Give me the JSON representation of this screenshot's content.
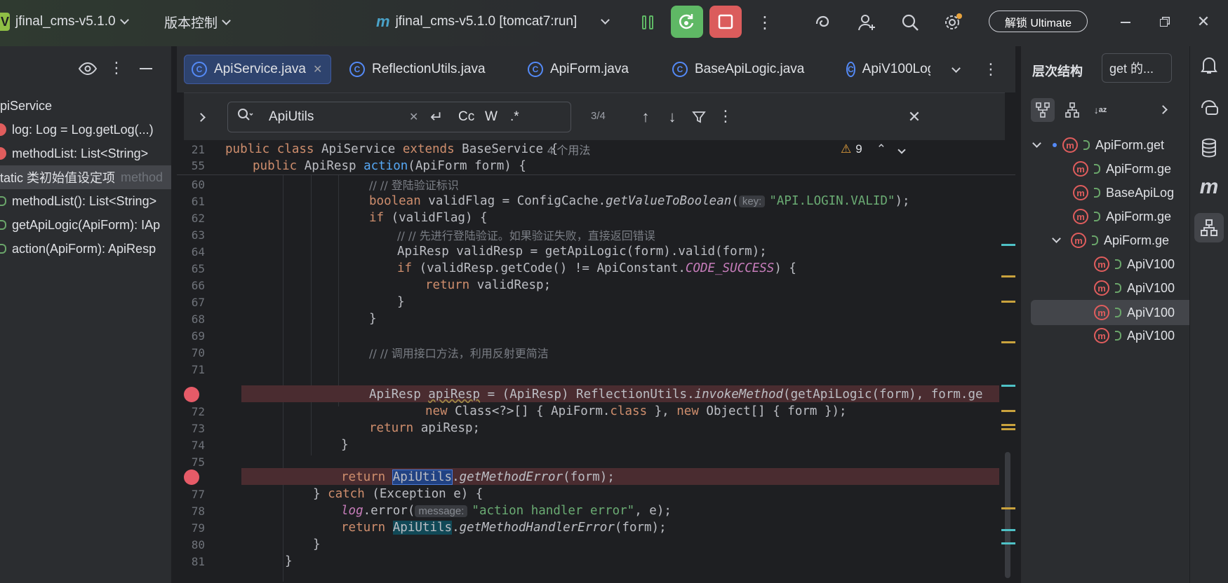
{
  "topbar": {
    "project_badge": "V",
    "project_name": "jfinal_cms-v5.1.0",
    "vcs": "版本控制",
    "run_config": "jfinal_cms-v5.1.0 [tomcat7:run]",
    "unlock": "解锁 Ultimate"
  },
  "structure": {
    "items": [
      {
        "label": "piService",
        "kind": "class"
      },
      {
        "label": "log: Log = Log.getLog(...)",
        "kind": "field"
      },
      {
        "label": "methodList: List<String>",
        "kind": "field"
      },
      {
        "label": "tatic 类初始值设定项",
        "suffix": "method",
        "kind": "init"
      },
      {
        "label": "methodList(): List<String>",
        "kind": "method"
      },
      {
        "label": "getApiLogic(ApiForm): IAp",
        "kind": "method"
      },
      {
        "label": "action(ApiForm): ApiResp",
        "kind": "method"
      }
    ]
  },
  "tabs": [
    {
      "label": "ApiService.java",
      "active": true
    },
    {
      "label": "ReflectionUtils.java",
      "active": false
    },
    {
      "label": "ApiForm.java",
      "active": false
    },
    {
      "label": "BaseApiLogic.java",
      "active": false
    },
    {
      "label": "ApiV100Log",
      "active": false
    }
  ],
  "find": {
    "query": "ApiUtils",
    "case_label": "Cc",
    "word_label": "W",
    "regex_label": ".*",
    "count": "3/4"
  },
  "sticky": {
    "l21_num": "21",
    "l21_text": "public class ApiService extends BaseService {",
    "l21_usages": "4 个用法",
    "l55_num": "55",
    "warnings": "9"
  },
  "code_lines": [
    {
      "n": "60"
    },
    {
      "n": "61"
    },
    {
      "n": "62"
    },
    {
      "n": "63"
    },
    {
      "n": "64"
    },
    {
      "n": "65"
    },
    {
      "n": "66"
    },
    {
      "n": "67"
    },
    {
      "n": "68"
    },
    {
      "n": "69"
    },
    {
      "n": "70"
    },
    {
      "n": "71"
    },
    {
      "n": "72"
    },
    {
      "n": "73"
    },
    {
      "n": "74"
    },
    {
      "n": "75"
    },
    {
      "n": "76"
    },
    {
      "n": "77"
    },
    {
      "n": "78"
    },
    {
      "n": "79"
    },
    {
      "n": "80"
    },
    {
      "n": "81"
    }
  ],
  "code": {
    "c60": "// 登陆验证标识",
    "c63": "// 先进行登陆验证。如果验证失败，直接返回错误",
    "c70": "// 调用接口方法，利用反射更简洁",
    "hint_key": "key:",
    "hint_message": "message:",
    "str_login": "\"API.LOGIN.VALID\"",
    "str_error": "\"action handler error\"",
    "const_success": "CODE_SUCCESS"
  },
  "hierarchy": {
    "title": "层次结构",
    "scope": "get 的...",
    "items": [
      {
        "label": "ApiForm.get",
        "indent": 0,
        "expanded": true
      },
      {
        "label": "ApiForm.ge",
        "indent": 1
      },
      {
        "label": "BaseApiLog",
        "indent": 1
      },
      {
        "label": "ApiForm.ge",
        "indent": 1
      },
      {
        "label": "ApiForm.ge",
        "indent": 1,
        "expanded": true
      },
      {
        "label": "ApiV100",
        "indent": 2
      },
      {
        "label": "ApiV100",
        "indent": 2
      },
      {
        "label": "ApiV100",
        "indent": 2,
        "selected": true
      },
      {
        "label": "ApiV100",
        "indent": 2
      }
    ]
  },
  "colors": {
    "accent": "#548af7",
    "run_green": "#5fb865",
    "stop_red": "#db5c5c",
    "breakpoint": "#e65b68"
  }
}
